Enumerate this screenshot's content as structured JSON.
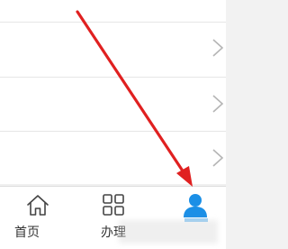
{
  "tabs": [
    {
      "label": "首页",
      "icon": "home-icon"
    },
    {
      "label": "办理",
      "icon": "grid-icon"
    },
    {
      "label": "",
      "icon": "person-icon",
      "active": true
    }
  ],
  "colors": {
    "accent": "#1b8fe6",
    "annotation_arrow": "#e02020",
    "chevron": "#b5b5b5"
  }
}
